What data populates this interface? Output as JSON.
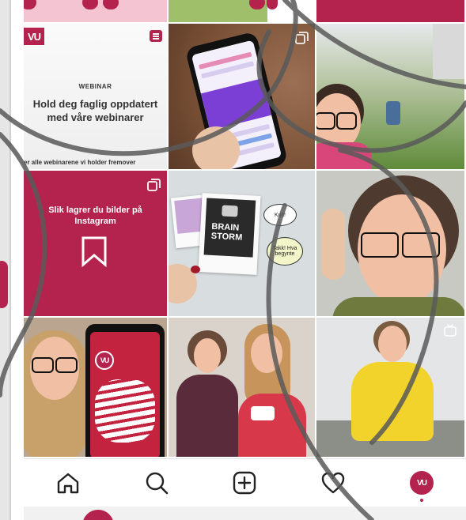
{
  "grid": {
    "webinar": {
      "logo_text": "VU",
      "kicker": "WEBINAR",
      "title": "Hold deg faglig oppdatert med våre webinarer",
      "footer": "er alle webinarene vi holder fremover"
    },
    "tip": {
      "title": "Slik lagrer du bilder på Instagram"
    },
    "polaroid": {
      "brainstorm_text": "BRAIN STORM",
      "bubble_kult": "Kult!",
      "bubble_thanks": "Takk! Hva begynte"
    },
    "selfie_phone": {
      "logo_text": "VU"
    }
  },
  "bottom_nav": {
    "items": [
      {
        "name": "home",
        "icon": "home-icon"
      },
      {
        "name": "search",
        "icon": "search-icon"
      },
      {
        "name": "new-post",
        "icon": "plus-square-icon"
      },
      {
        "name": "activity",
        "icon": "heart-icon"
      },
      {
        "name": "profile",
        "icon": "avatar",
        "label": "VU"
      }
    ]
  },
  "colors": {
    "brand": "#b4234e",
    "ink": "#333333",
    "scribble": "#555555"
  }
}
